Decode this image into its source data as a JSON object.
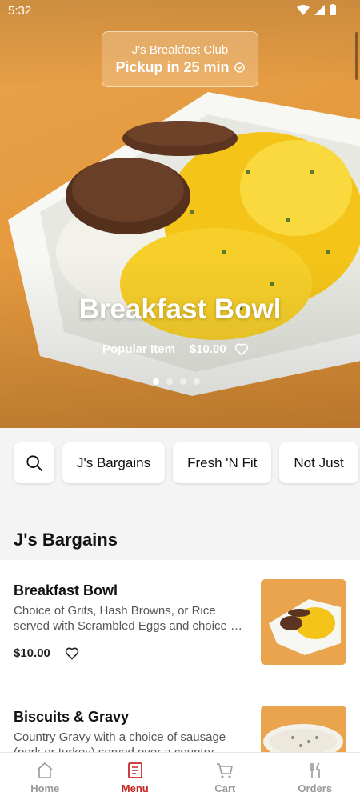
{
  "status": {
    "time": "5:32"
  },
  "hero": {
    "restaurant": "J's Breakfast Club",
    "pickup": "Pickup in 25 min",
    "title": "Breakfast Bowl",
    "tag": "Popular Item",
    "price": "$10.00",
    "slides": 4,
    "active_slide": 1
  },
  "categories": [
    "J's Bargains",
    "Fresh 'N Fit",
    "Not Just"
  ],
  "section": {
    "title": "J's Bargains"
  },
  "items": [
    {
      "name": "Breakfast Bowl",
      "desc": "Choice of Grits, Hash Browns, or Rice served with Scrambled Eggs and choice of sausage",
      "price": "$10.00"
    },
    {
      "name": "Biscuits & Gravy",
      "desc": "Country Gravy with a choice of sausage (pork or turkey) served over a country biscuit",
      "price": ""
    }
  ],
  "nav": [
    {
      "label": "Home",
      "icon": "home-icon"
    },
    {
      "label": "Menu",
      "icon": "menu-book-icon",
      "active": true
    },
    {
      "label": "Cart",
      "icon": "cart-icon"
    },
    {
      "label": "Orders",
      "icon": "fork-knife-icon"
    }
  ],
  "colors": {
    "accent": "#c62828",
    "hero_bg": "#e59a3f",
    "egg": "#f4c518"
  }
}
